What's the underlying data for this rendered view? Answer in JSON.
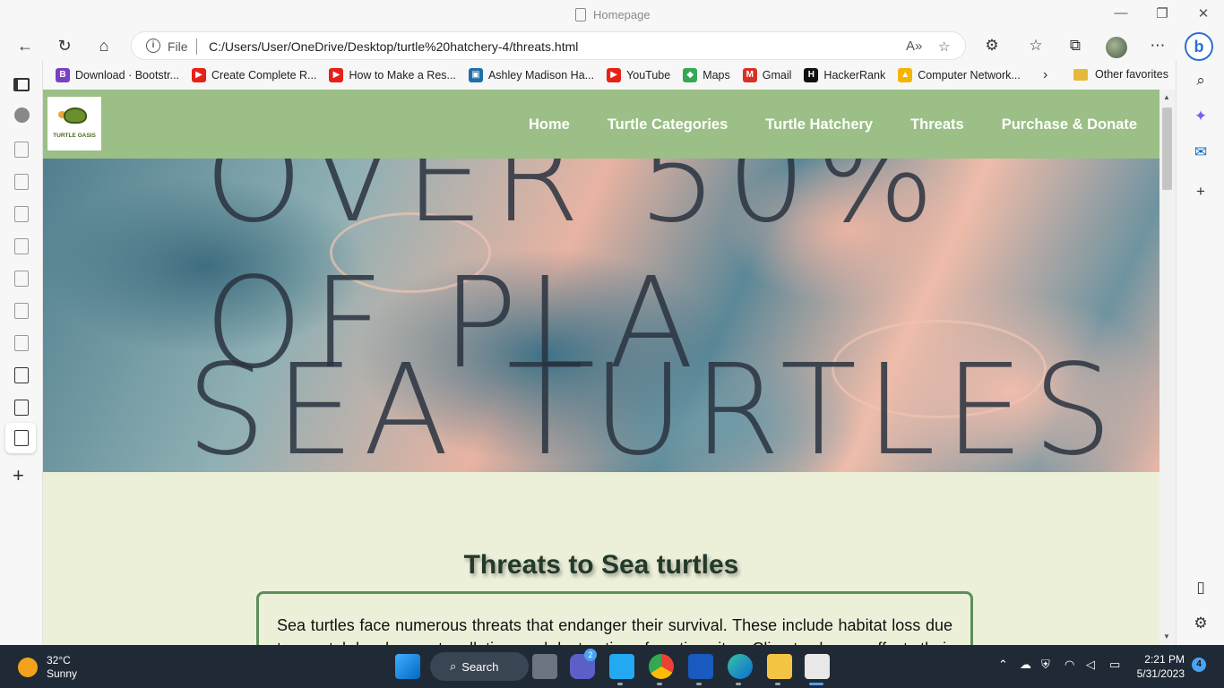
{
  "window": {
    "title": "Homepage",
    "controls": {
      "minimize": "—",
      "restore": "❐",
      "close": "✕"
    }
  },
  "toolbar": {
    "back": "←",
    "refresh": "↻",
    "home": "⌂",
    "file_label": "File",
    "url": "C:/Users/User/OneDrive/Desktop/turtle%20hatchery-4/threats.html",
    "read_aloud": "A»",
    "favorite": "☆",
    "extensions": "⚙",
    "favorites": "☆",
    "collections": "⧉",
    "more": "⋯",
    "bing": "b"
  },
  "favorites": [
    {
      "label": "Download · Bootstr...",
      "icon": "B",
      "color": "#7b3fc4"
    },
    {
      "label": "Create Complete R...",
      "icon": "▶",
      "color": "#e62117"
    },
    {
      "label": "How to Make a Res...",
      "icon": "▶",
      "color": "#e62117"
    },
    {
      "label": "Ashley Madison Ha...",
      "icon": "▣",
      "color": "#1f6fa8"
    },
    {
      "label": "YouTube",
      "icon": "▶",
      "color": "#e62117"
    },
    {
      "label": "Maps",
      "icon": "◆",
      "color": "#34a853"
    },
    {
      "label": "Gmail",
      "icon": "M",
      "color": "#d93025"
    },
    {
      "label": "HackerRank",
      "icon": "H",
      "color": "#111111"
    },
    {
      "label": "Computer Network...",
      "icon": "▲",
      "color": "#f4b400"
    }
  ],
  "favorites_more": "›",
  "other_favorites": "Other favorites",
  "site": {
    "logo_text": "TURTLE OASIS",
    "menu": [
      "Home",
      "Turtle Categories",
      "Turtle Hatchery",
      "Threats",
      "Purchase & Donate"
    ],
    "hero_text_top": "OVER 50% OF PLA",
    "hero_text_bottom": "SEA TURTLES HAVE TA",
    "heading": "Threats to Sea turtles",
    "paragraph": "Sea turtles face numerous threats that endanger their survival. These include habitat loss due to coastal development, pollution, and destruction of nesting sites. Climate change affects their"
  },
  "right_sidebar": {
    "search": "⌕",
    "add": "+",
    "split": "▯",
    "settings": "⚙"
  },
  "taskbar": {
    "temperature": "32°C",
    "condition": "Sunny",
    "search_label": "Search",
    "teams_badge": "2",
    "time": "2:21 PM",
    "date": "5/31/2023",
    "notifications": "4"
  }
}
